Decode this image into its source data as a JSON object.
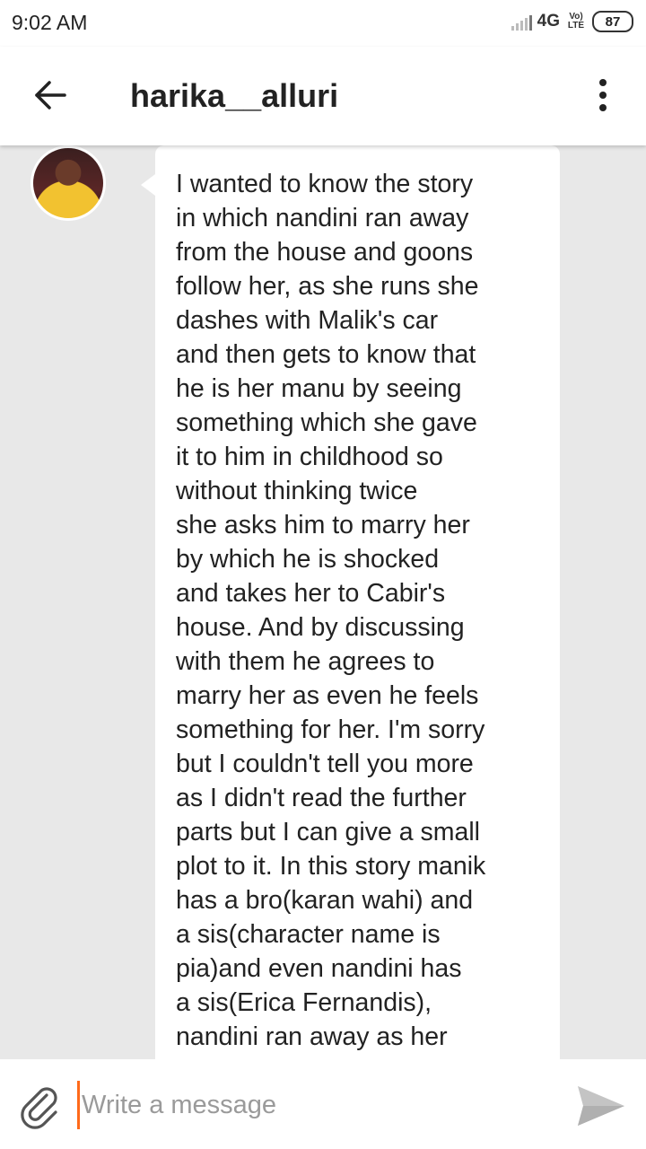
{
  "status_bar": {
    "time": "9:02 AM",
    "network": "4G",
    "volte": "Vo) LTE",
    "battery": "87"
  },
  "header": {
    "title": "harika__alluri"
  },
  "messages": [
    {
      "text": "I wanted to know the story\nin which nandini ran away\nfrom the house and goons\nfollow her, as she runs she\ndashes with Malik's car\nand then gets to know that\nhe is her manu by seeing\nsomething which she gave\nit to him in childhood so\nwithout thinking twice\nshe asks him to marry her\nby which he is shocked\nand takes her to Cabir's\nhouse. And by discussing\nwith them he agrees to\nmarry her as even he feels\nsomething for her. I'm sorry\nbut I couldn't tell you more\nas I didn't read the further\nparts but I can give a small\nplot to it. In this story manik\nhas a bro(karan wahi) and\na sis(character name is\npia)and even nandini has\na sis(Erica Fernandis),\nnandini ran away as her"
    }
  ],
  "composer": {
    "placeholder": "Write a message"
  },
  "icons": {
    "back": "arrow-left",
    "more": "vertical-ellipsis",
    "attach": "paperclip",
    "send": "paper-plane"
  },
  "colors": {
    "cursor": "#ff6a1a",
    "background": "#e8e8e8"
  }
}
